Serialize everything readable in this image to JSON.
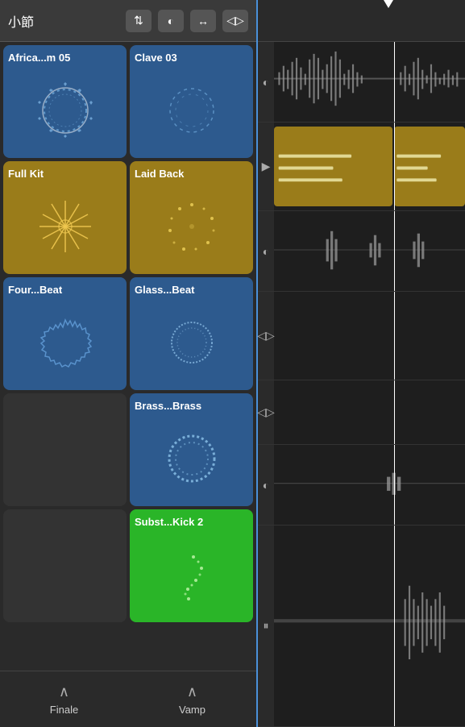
{
  "header": {
    "title": "小節",
    "moon_btn": "◐",
    "arrows_btn": "↔",
    "expand_btn": "◁▷"
  },
  "pads": [
    {
      "id": "pad1",
      "label": "Africa...m 05",
      "color": "blue",
      "shape": "circle_ring"
    },
    {
      "id": "pad2",
      "label": "Clave 03",
      "color": "blue",
      "shape": "circle_ring_thin"
    },
    {
      "id": "pad3",
      "label": "Full Kit",
      "color": "gold",
      "shape": "circle_burst"
    },
    {
      "id": "pad4",
      "label": "Laid Back",
      "color": "gold",
      "shape": "circle_dots"
    },
    {
      "id": "pad5",
      "label": "Four...Beat",
      "color": "blue",
      "shape": "circle_jagged"
    },
    {
      "id": "pad6",
      "label": "Glass...Beat",
      "color": "blue",
      "shape": "circle_ring_med"
    },
    {
      "id": "pad7",
      "label": "",
      "color": "empty",
      "shape": "none"
    },
    {
      "id": "pad8",
      "label": "Brass...Brass",
      "color": "blue",
      "shape": "circle_ring_thick"
    },
    {
      "id": "pad9",
      "label": "",
      "color": "empty",
      "shape": "none"
    },
    {
      "id": "pad10",
      "label": "Subst...Kick 2",
      "color": "green",
      "shape": "circle_sparse"
    }
  ],
  "bottom_buttons": [
    {
      "label": "Finale",
      "icon": "∧"
    },
    {
      "label": "Vamp",
      "icon": "∧"
    }
  ],
  "tracks": [
    {
      "control_icon": "◐",
      "type": "waveform"
    },
    {
      "control_icon": "▶",
      "type": "gold_pattern"
    },
    {
      "control_icon": "◐",
      "type": "waveform_sparse"
    },
    {
      "control_icon": "◁▷",
      "type": "empty"
    },
    {
      "control_icon": "◁▷",
      "type": "empty"
    },
    {
      "control_icon": "◐",
      "type": "waveform_bottom"
    },
    {
      "control_icon": "⏸",
      "type": "waveform_end"
    }
  ]
}
